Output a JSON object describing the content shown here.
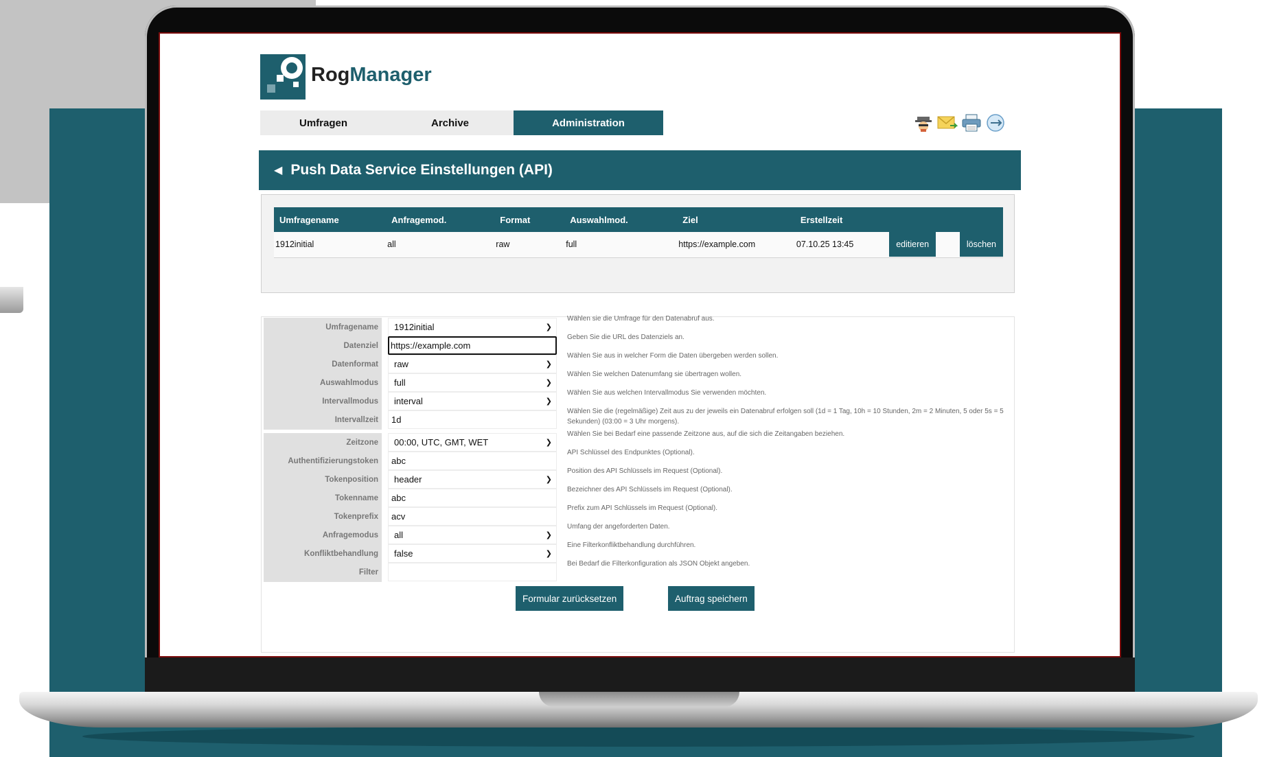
{
  "brand": {
    "part1": "Rog",
    "part2": "Manager"
  },
  "nav": {
    "tabs": [
      {
        "label": "Umfragen",
        "active": false
      },
      {
        "label": "Archive",
        "active": false
      },
      {
        "label": "Administration",
        "active": true
      }
    ]
  },
  "toolbar": {
    "icons": [
      "agent-icon",
      "mail-icon",
      "printer-icon",
      "logout-icon"
    ]
  },
  "section": {
    "title": "Push Data Service Einstellungen (API)"
  },
  "jobs_table": {
    "headers": [
      "Umfragename",
      "Anfragemod.",
      "Format",
      "Auswahlmod.",
      "Ziel",
      "Erstellzeit",
      "",
      ""
    ],
    "rows": [
      {
        "umfragename": "1912initial",
        "anfragemodus": "all",
        "format": "raw",
        "auswahlmodus": "full",
        "ziel": "https://example.com",
        "erstellzeit": "07.10.25 13:45",
        "edit_label": "editieren",
        "delete_label": "löschen"
      }
    ]
  },
  "form": {
    "fields": [
      {
        "label": "Umfragename",
        "type": "select",
        "value": "1912initial",
        "help": "Wählen sie die Umfrage für den Datenabruf aus."
      },
      {
        "label": "Datenziel",
        "type": "input",
        "value": "https://example.com",
        "focused": true,
        "help": "Geben Sie die URL des Datenziels an."
      },
      {
        "label": "Datenformat",
        "type": "select",
        "value": "raw",
        "help": "Wählen Sie aus in welcher Form die Daten übergeben werden sollen."
      },
      {
        "label": "Auswahlmodus",
        "type": "select",
        "value": "full",
        "help": "Wählen Sie welchen Datenumfang sie übertragen wollen."
      },
      {
        "label": "Intervallmodus",
        "type": "select",
        "value": "interval",
        "help": "Wählen Sie aus welchen Intervallmodus Sie verwenden möchten."
      },
      {
        "label": "Intervallzeit",
        "type": "input",
        "value": "1d",
        "help": "Wählen Sie die (regelmäßige) Zeit aus zu der jeweils ein Datenabruf erfolgen soll (1d = 1 Tag, 10h = 10 Stunden, 2m = 2 Minuten, 5 oder 5s = 5 Sekunden) (03:00 = 3 Uhr morgens)."
      },
      {
        "label": "Zeitzone",
        "type": "select",
        "value": "00:00, UTC, GMT, WET",
        "help": "Wählen Sie bei Bedarf eine passende Zeitzone aus, auf die sich die Zeitangaben beziehen."
      },
      {
        "label": "Authentifizierungstoken",
        "type": "input",
        "value": "abc",
        "help": "API Schlüssel des Endpunktes (Optional)."
      },
      {
        "label": "Tokenposition",
        "type": "select",
        "value": "header",
        "help": "Position des API Schlüssels im Request (Optional)."
      },
      {
        "label": "Tokenname",
        "type": "input",
        "value": "abc",
        "help": "Bezeichner des API Schlüssels im Request (Optional)."
      },
      {
        "label": "Tokenprefix",
        "type": "input",
        "value": "acv",
        "help": "Prefix zum API Schlüssels im Request (Optional)."
      },
      {
        "label": "Anfragemodus",
        "type": "select",
        "value": "all",
        "help": "Umfang der angeforderten Daten."
      },
      {
        "label": "Konfliktbehandlung",
        "type": "select",
        "value": "false",
        "help": "Eine Filterkonfliktbehandlung durchführen."
      },
      {
        "label": "Filter",
        "type": "input",
        "value": "",
        "help": "Bei Bedarf die Filterkonfiguration als JSON Objekt angeben."
      }
    ],
    "reset_label": "Formular zurücksetzen",
    "save_label": "Auftrag speichern"
  },
  "colors": {
    "accent": "#1e5f6d",
    "label_bg": "#e0e0e0",
    "frame": "#7a0b0b"
  }
}
